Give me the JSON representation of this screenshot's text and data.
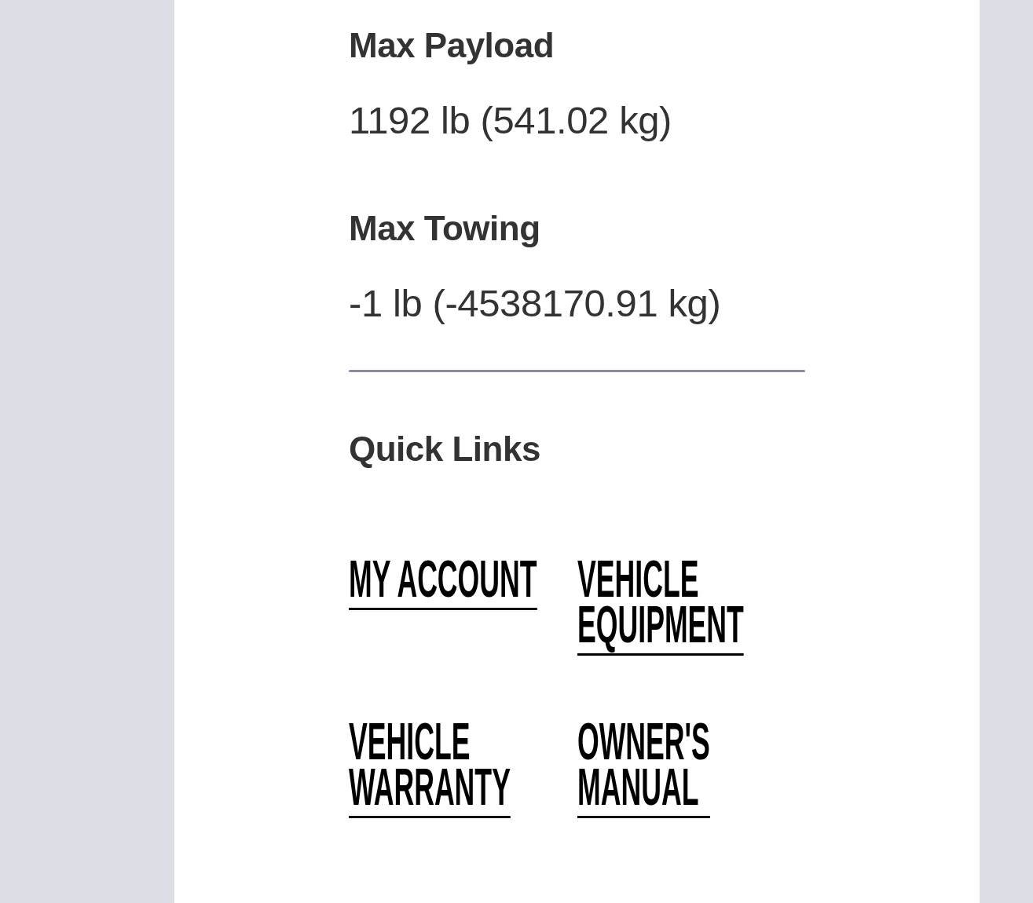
{
  "specs": [
    {
      "label": "Max Payload",
      "value": "1192 lb (541.02 kg)"
    },
    {
      "label": "Max Towing",
      "value": "-1 lb (-4538170.91 kg)"
    }
  ],
  "quick_links": {
    "title": "Quick Links",
    "links": [
      "MY ACCOUNT",
      "VEHICLE EQUIPMENT",
      "VEHICLE WARRANTY",
      "OWNER'S MANUAL"
    ]
  }
}
